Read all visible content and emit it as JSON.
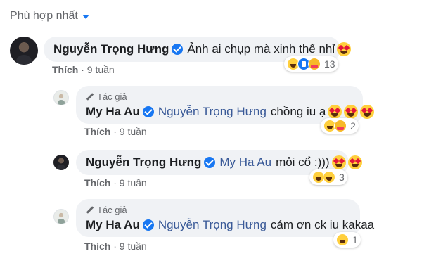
{
  "sort": {
    "label": "Phù hợp nhất"
  },
  "colors": {
    "link": "#3a5a98",
    "verified": "#1877f2",
    "bubble": "#f0f2f5"
  },
  "comments": [
    {
      "author": "Nguyễn Trọng Hưng",
      "text": "Ảnh ai chụp mà xinh thế nhỉ",
      "like": "Thích",
      "time": "9 tuần",
      "reactions": [
        "haha",
        "like",
        "care"
      ],
      "count": "13"
    },
    {
      "badge": "Tác giả",
      "author": "My Ha Au",
      "mention": "Nguyễn Trọng Hưng",
      "text": "chồng iu ạ",
      "like": "Thích",
      "time": "9 tuần",
      "reactions": [
        "haha",
        "care"
      ],
      "count": "2"
    },
    {
      "author": "Nguyễn Trọng Hưng",
      "mention": "My Ha Au",
      "text": "mỏi cổ :)))",
      "like": "Thích",
      "time": "9 tuần",
      "reactions": [
        "haha",
        "haha"
      ],
      "count": "3"
    },
    {
      "badge": "Tác giả",
      "author": "My Ha Au",
      "mention": "Nguyễn Trọng Hưng",
      "text": "cám ơn ck iu kakaa",
      "like": "Thích",
      "time": "9 tuần",
      "reactions": [
        "haha"
      ],
      "count": "1"
    }
  ]
}
